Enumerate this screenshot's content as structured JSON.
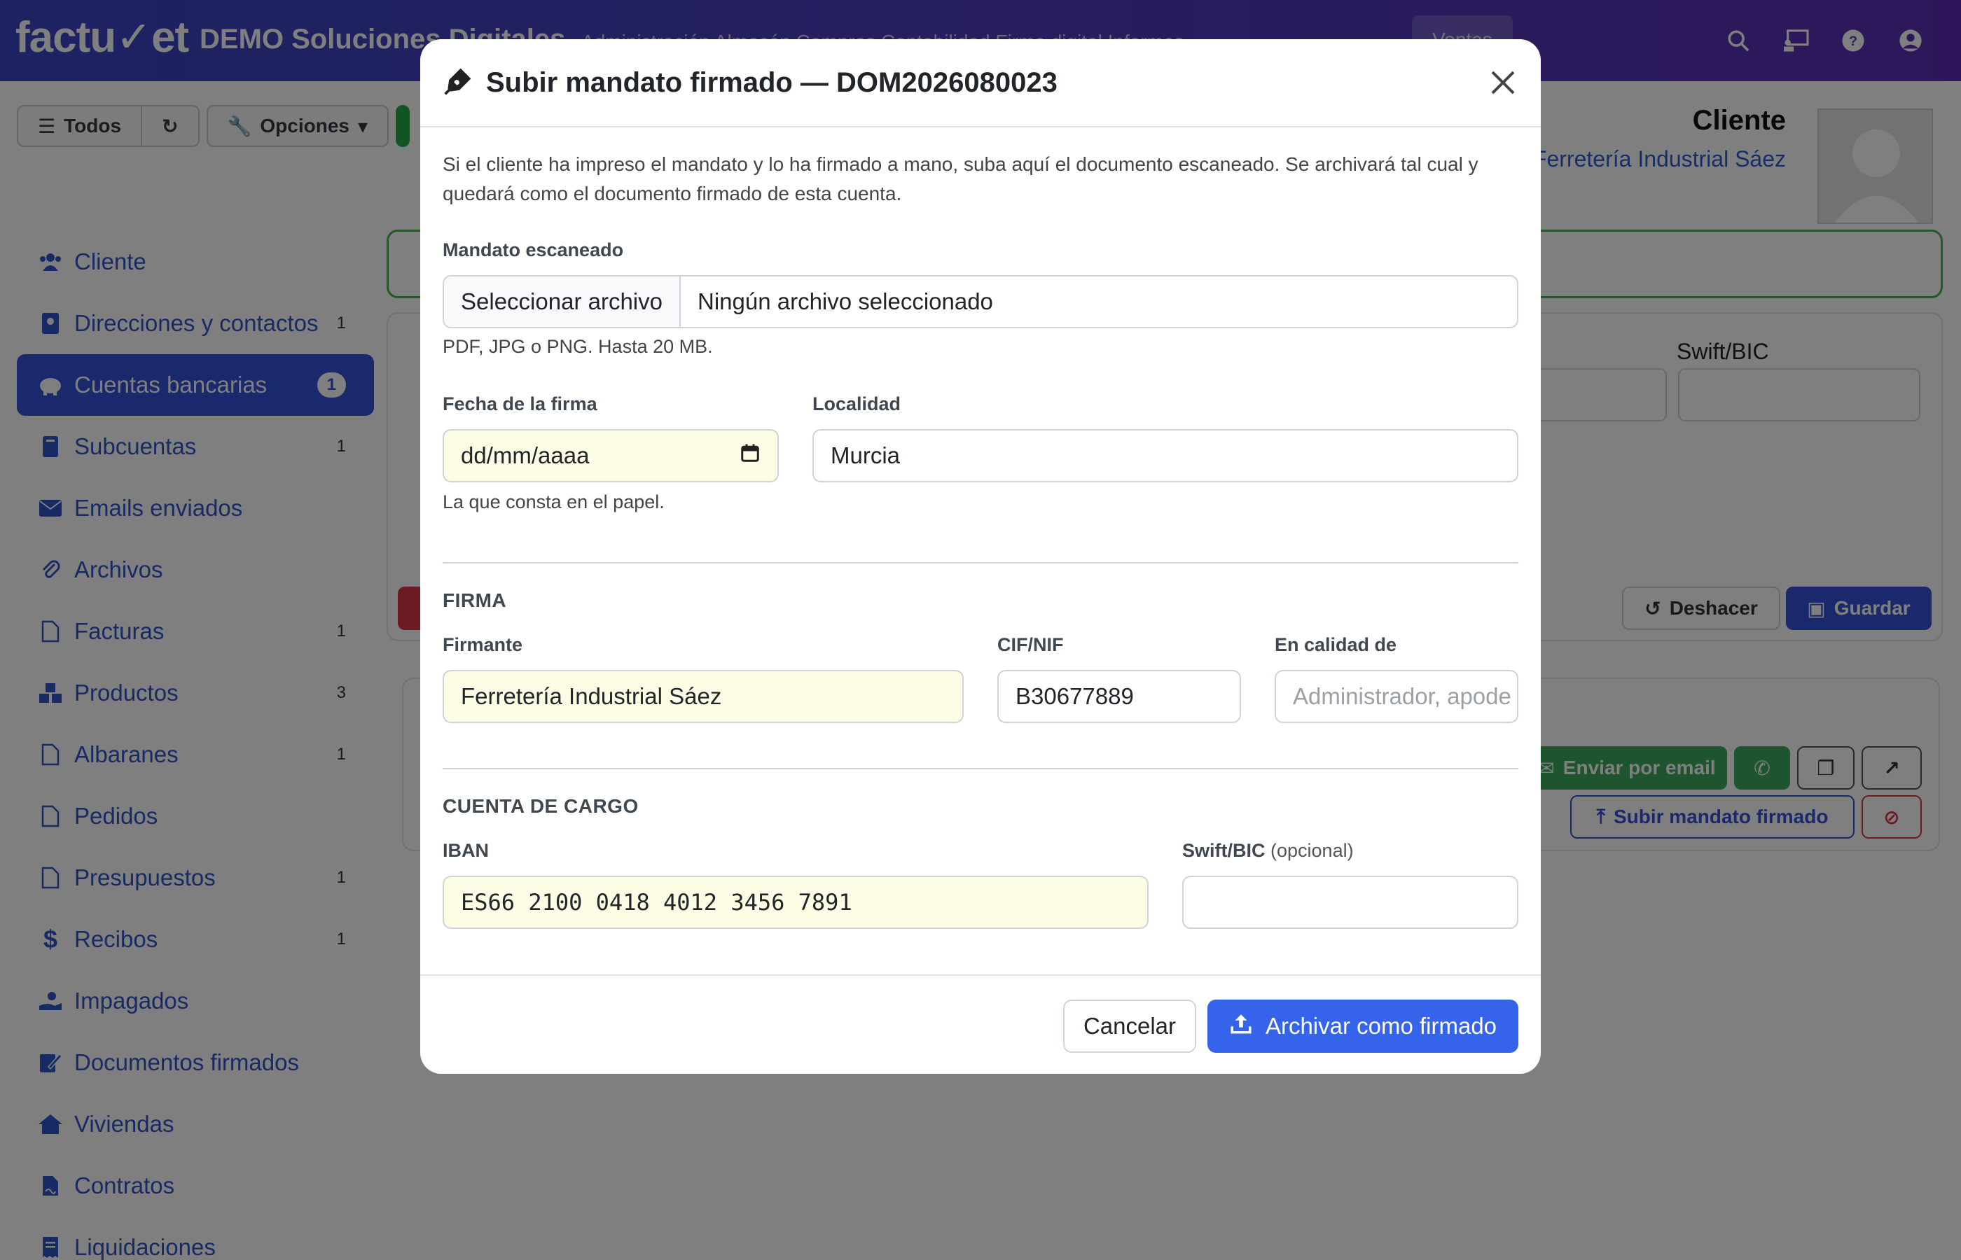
{
  "app": {
    "logo": "factu✓et",
    "company": "DEMO Soluciones Digitales",
    "topnav": "Administración    Almacén    Compras    Contabilidad    Firma digital    Informes",
    "ventas_label": "Ventas"
  },
  "toolbar": {
    "todos_label": "Todos",
    "opciones_label": "Opciones"
  },
  "cliente": {
    "title": "Cliente",
    "name": "Ferretería Industrial Sáez"
  },
  "sidebar": {
    "items": [
      {
        "label": "Cliente",
        "count": "",
        "icon": "users-icon"
      },
      {
        "label": "Direcciones y contactos",
        "count": "1",
        "icon": "address-book-icon"
      },
      {
        "label": "Cuentas bancarias",
        "count": "1",
        "icon": "piggy-bank-icon"
      },
      {
        "label": "Subcuentas",
        "count": "1",
        "icon": "book-icon"
      },
      {
        "label": "Emails enviados",
        "count": "",
        "icon": "envelope-icon"
      },
      {
        "label": "Archivos",
        "count": "",
        "icon": "paperclip-icon"
      },
      {
        "label": "Facturas",
        "count": "1",
        "icon": "file-icon"
      },
      {
        "label": "Productos",
        "count": "3",
        "icon": "cubes-icon"
      },
      {
        "label": "Albaranes",
        "count": "1",
        "icon": "file-icon"
      },
      {
        "label": "Pedidos",
        "count": "",
        "icon": "file-icon"
      },
      {
        "label": "Presupuestos",
        "count": "1",
        "icon": "file-icon"
      },
      {
        "label": "Recibos",
        "count": "1",
        "icon": "dollar-icon"
      },
      {
        "label": "Impagados",
        "count": "",
        "icon": "hand-holding-icon"
      },
      {
        "label": "Documentos firmados",
        "count": "",
        "icon": "signature-icon"
      },
      {
        "label": "Viviendas",
        "count": "",
        "icon": "home-icon"
      },
      {
        "label": "Contratos",
        "count": "",
        "icon": "file-contract-icon"
      },
      {
        "label": "Liquidaciones",
        "count": "",
        "icon": "receipt-icon"
      }
    ]
  },
  "background": {
    "swift_label": "Swift/BIC",
    "deshacer_label": "Deshacer",
    "guardar_label": "Guardar",
    "enviar_email_label": "Enviar por email",
    "subir_mandato_label": "Subir mandato firmado"
  },
  "modal": {
    "title": "Subir mandato firmado — DOM2026080023",
    "intro": "Si el cliente ha impreso el mandato y lo ha firmado a mano, suba aquí el documento escaneado. Se archivará tal cual y quedará como el documento firmado de esta cuenta.",
    "file": {
      "label": "Mandato escaneado",
      "button": "Seleccionar archivo",
      "status": "Ningún archivo seleccionado",
      "help": "PDF, JPG o PNG. Hasta 20 MB."
    },
    "fecha": {
      "label": "Fecha de la firma",
      "value": "dd/mm/aaaa",
      "help": "La que consta en el papel."
    },
    "localidad": {
      "label": "Localidad",
      "value": "Murcia"
    },
    "firma_section": "FIRMA",
    "firmante": {
      "label": "Firmante",
      "value": "Ferretería Industrial Sáez"
    },
    "cif": {
      "label": "CIF/NIF",
      "value": "B30677889"
    },
    "calidad": {
      "label": "En calidad de",
      "placeholder": "Administrador, apode"
    },
    "cuenta_section": "CUENTA DE CARGO",
    "iban": {
      "label": "IBAN",
      "value": "ES66 2100 0418 4012 3456 7891"
    },
    "swift": {
      "label": "Swift/BIC",
      "optional": "(opcional)",
      "value": ""
    },
    "cancel_label": "Cancelar",
    "submit_label": "Archivar como firmado"
  },
  "colors": {
    "primary": "#3563e9",
    "sidebar_active": "#3553d6",
    "highlight_field": "#fdfde6",
    "success": "#4caf50",
    "danger": "#dc3545"
  }
}
